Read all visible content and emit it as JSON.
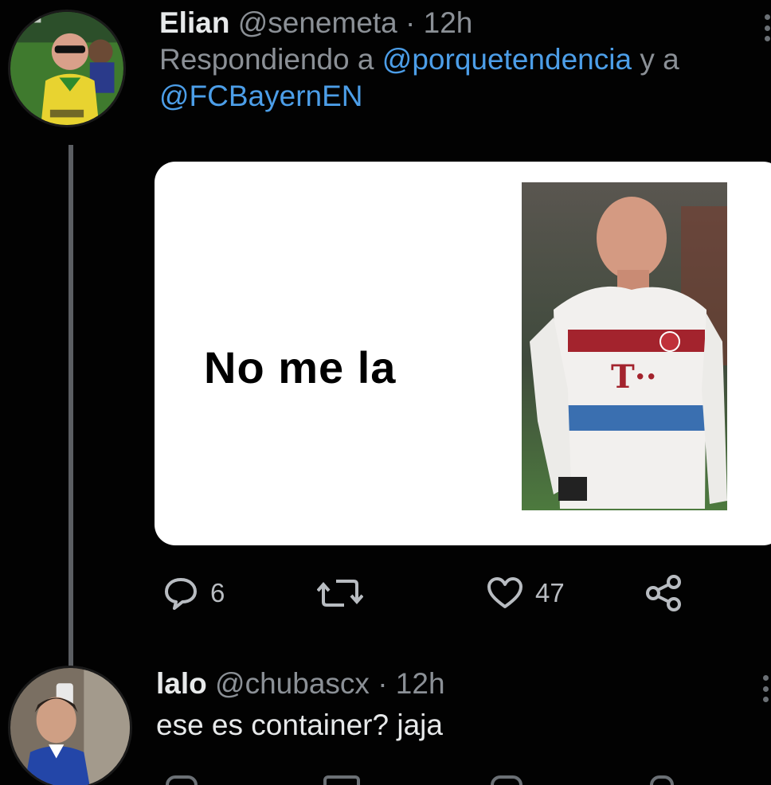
{
  "tweet_main": {
    "author_name": "Elian",
    "handle": "@senemeta",
    "separator": "·",
    "time": "12h",
    "replying_prefix": "Respondiendo a",
    "reply_to_1": "@porquetendencia",
    "reply_connector": "y a",
    "reply_to_2": "@FCBayernEN",
    "media_caption": "No me la",
    "media_jersey_mark": "T··",
    "reply_count": "6",
    "retweet_count": "",
    "like_count": "47"
  },
  "tweet_reply": {
    "author_name": "lalo",
    "handle": "@chubascx",
    "separator": "·",
    "time": "12h",
    "text": "ese es container? jaja"
  },
  "colors": {
    "background": "#020202",
    "text": "#e7e9ea",
    "muted": "#8b9096",
    "link": "#4c9ee8",
    "thread_line": "#5b5e62"
  },
  "icons": [
    "reply-icon",
    "retweet-icon",
    "like-icon",
    "share-icon",
    "more-options-icon"
  ]
}
